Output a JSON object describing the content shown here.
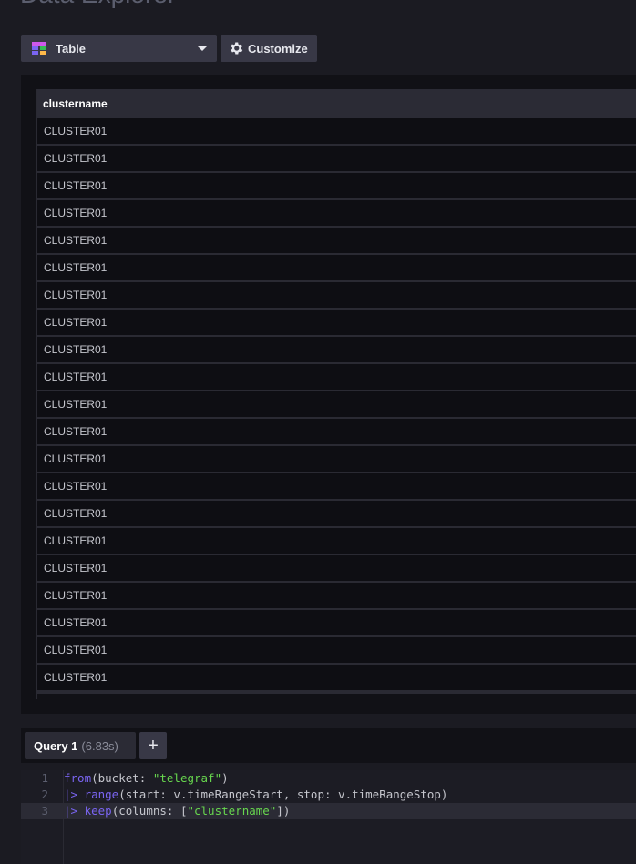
{
  "page": {
    "title": "Data Explorer"
  },
  "toolbar": {
    "visualization_label": "Table",
    "customize_label": "Customize"
  },
  "table": {
    "columns": [
      "clustername"
    ],
    "rows": [
      "CLUSTER01",
      "CLUSTER01",
      "CLUSTER01",
      "CLUSTER01",
      "CLUSTER01",
      "CLUSTER01",
      "CLUSTER01",
      "CLUSTER01",
      "CLUSTER01",
      "CLUSTER01",
      "CLUSTER01",
      "CLUSTER01",
      "CLUSTER01",
      "CLUSTER01",
      "CLUSTER01",
      "CLUSTER01",
      "CLUSTER01",
      "CLUSTER01",
      "CLUSTER01",
      "CLUSTER01",
      "CLUSTER01"
    ]
  },
  "query": {
    "tab_name": "Query 1",
    "tab_time": "(6.83s)",
    "add_label": "+"
  },
  "editor": {
    "lines": [
      {
        "num": "1",
        "parts": [
          {
            "t": "from",
            "c": "kw"
          },
          {
            "t": "(bucket: ",
            "c": ""
          },
          {
            "t": "\"telegraf\"",
            "c": "str"
          },
          {
            "t": ")",
            "c": ""
          }
        ]
      },
      {
        "num": "2",
        "parts": [
          {
            "t": "|> ",
            "c": "kw"
          },
          {
            "t": "range",
            "c": "fn"
          },
          {
            "t": "(start: v.timeRangeStart, stop: v.timeRangeStop)",
            "c": ""
          }
        ]
      },
      {
        "num": "3",
        "parts": [
          {
            "t": "|> ",
            "c": "kw"
          },
          {
            "t": "keep",
            "c": "fn"
          },
          {
            "t": "(columns: [",
            "c": ""
          },
          {
            "t": "\"clustername\"",
            "c": "str"
          },
          {
            "t": "])",
            "c": ""
          }
        ]
      }
    ],
    "active_line": 3
  },
  "colors": {
    "background": "#1b1b22",
    "keyword": "#7a65f2",
    "string": "#67d74e"
  }
}
